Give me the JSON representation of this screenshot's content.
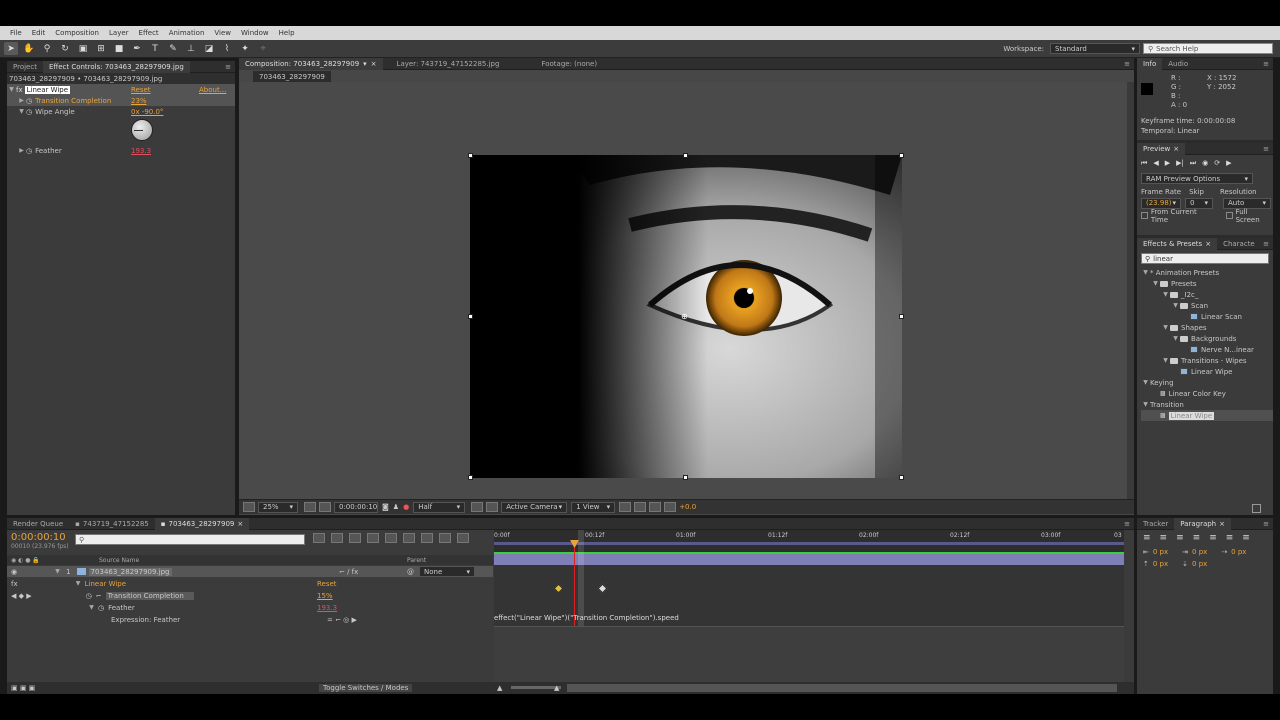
{
  "menubar": {
    "items": [
      "File",
      "Edit",
      "Composition",
      "Layer",
      "Effect",
      "Animation",
      "View",
      "Window",
      "Help"
    ]
  },
  "toolbar": {
    "workspace_label": "Workspace:",
    "workspace_value": "Standard",
    "search_placeholder": "Search Help"
  },
  "left_panel": {
    "tabs": [
      "Project",
      "Effect Controls: 703463_28297909.jpg"
    ],
    "breadcrumb": "703463_28297909 • 703463_28297909.jpg",
    "effect": {
      "name": "Linear Wipe",
      "reset": "Reset",
      "about": "About..."
    },
    "props": [
      {
        "label": "Transition Completion",
        "value": "23%"
      },
      {
        "label": "Wipe Angle",
        "value": "0x -90.0°"
      },
      {
        "label": "Feather",
        "value": "193.3"
      }
    ]
  },
  "viewer": {
    "tabs": [
      "Composition: 703463_28297909",
      "Layer: 743719_47152285.jpg",
      "Footage: (none)"
    ],
    "comp_tab": "703463_28297909",
    "zoom": "25%",
    "timecode": "0:00:00:10",
    "resolution": "Half",
    "camera": "Active Camera",
    "views": "1 View",
    "exposure": "+0.0"
  },
  "info_panel": {
    "tabs": [
      "Info",
      "Audio"
    ],
    "rgba": [
      "R :",
      "G :",
      "B :",
      "A : 0"
    ],
    "x": "X : 1572",
    "y": "Y : 2052",
    "keyframe_time": "Keyframe time: 0:00:00:08",
    "temporal": "Temporal: Linear"
  },
  "preview_panel": {
    "title": "Preview",
    "ram_options": "RAM Preview Options",
    "frame_rate_label": "Frame Rate",
    "skip_label": "Skip",
    "resolution_label": "Resolution",
    "frame_rate": "(23.98)",
    "skip": "0",
    "resolution": "Auto",
    "from_current": "From Current Time",
    "full_screen": "Full Screen"
  },
  "effects_panel": {
    "tabs": [
      "Effects & Presets",
      "Characte"
    ],
    "search": "linear",
    "tree": [
      {
        "label": "* Animation Presets",
        "depth": 0,
        "kind": "arrow"
      },
      {
        "label": "Presets",
        "depth": 1,
        "kind": "folder"
      },
      {
        "label": "_I2c_",
        "depth": 2,
        "kind": "folder"
      },
      {
        "label": "Scan",
        "depth": 3,
        "kind": "folder"
      },
      {
        "label": "Linear Scan",
        "depth": 4,
        "kind": "preset"
      },
      {
        "label": "Shapes",
        "depth": 2,
        "kind": "folder"
      },
      {
        "label": "Backgrounds",
        "depth": 3,
        "kind": "folder"
      },
      {
        "label": "Nerve N...inear",
        "depth": 4,
        "kind": "preset"
      },
      {
        "label": "Transitions - Wipes",
        "depth": 2,
        "kind": "folder"
      },
      {
        "label": "Linear Wipe",
        "depth": 3,
        "kind": "preset"
      },
      {
        "label": "Keying",
        "depth": 0,
        "kind": "arrow"
      },
      {
        "label": "Linear Color Key",
        "depth": 1,
        "kind": "effect"
      },
      {
        "label": "Transition",
        "depth": 0,
        "kind": "arrow"
      },
      {
        "label": "Linear Wipe",
        "depth": 1,
        "kind": "effect-selected"
      }
    ]
  },
  "timeline": {
    "tabs": [
      "Render Queue",
      "743719_47152285",
      "703463_28297909"
    ],
    "timecode": "0:00:00:10",
    "fps": "00010 (23.976 fps)",
    "col_source": "Source Name",
    "col_parent": "Parent",
    "layer_num": "1",
    "layer_name": "703463_28297909.jpg",
    "parent_value": "None",
    "effect_name": "Linear Wipe",
    "reset": "Reset",
    "prop1": "Transition Completion",
    "prop1_value": "15%",
    "prop2": "Feather",
    "prop2_value": "193.3",
    "expr_label": "Expression: Feather",
    "expression": "effect(\"Linear Wipe\")(\"Transition Completion\").speed",
    "ruler": [
      "0:00f",
      "00:12f",
      "01:00f",
      "01:12f",
      "02:00f",
      "02:12f",
      "03:00f",
      "03"
    ],
    "toggle": "Toggle Switches / Modes"
  },
  "tracker_panel": {
    "tabs": [
      "Tracker",
      "Paragraph"
    ],
    "px_values": [
      "0 px",
      "0 px",
      "0 px",
      "0 px",
      "0 px"
    ]
  }
}
